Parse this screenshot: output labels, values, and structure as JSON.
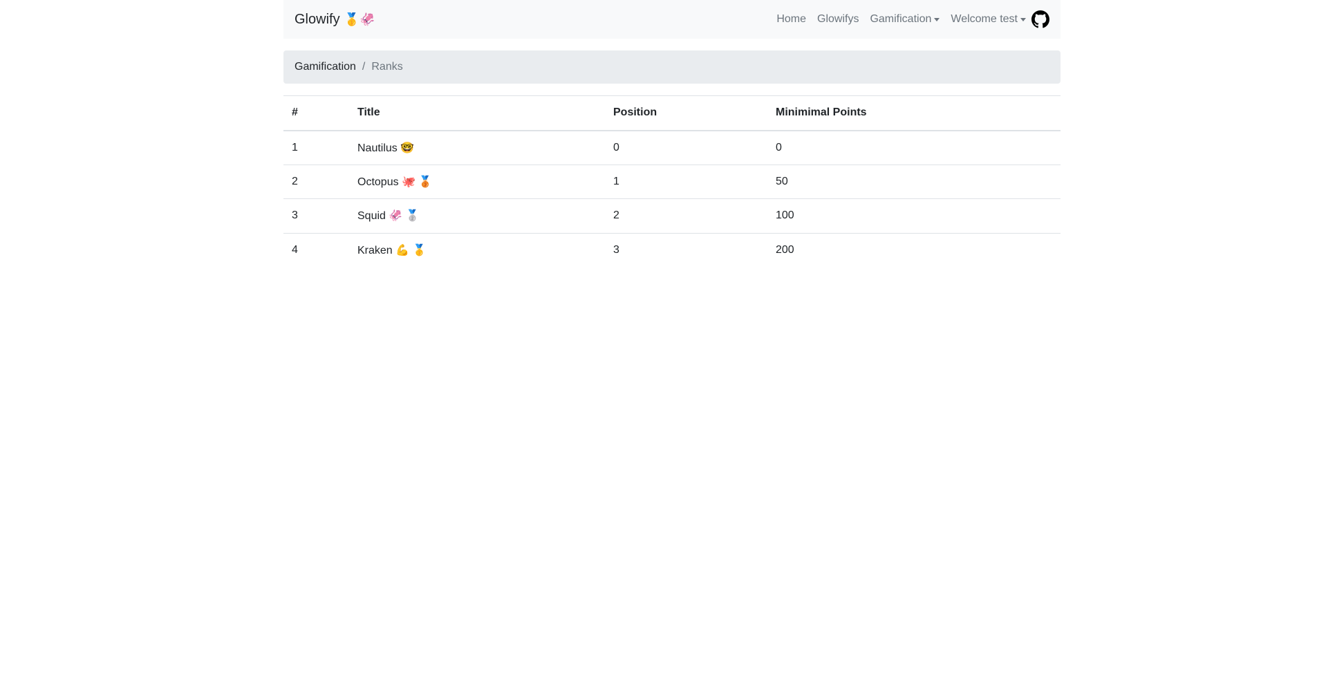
{
  "navbar": {
    "brand": "Glowify",
    "brand_icons": "🥇🦑",
    "links": {
      "home": "Home",
      "glowifys": "Glowifys",
      "gamification": "Gamification",
      "user": "Welcome test"
    },
    "github_icon": "github-icon"
  },
  "breadcrumb": {
    "parent": "Gamification",
    "current": "Ranks"
  },
  "table": {
    "headers": {
      "num": "#",
      "title": "Title",
      "position": "Position",
      "points": "Minimimal Points"
    },
    "rows": [
      {
        "num": "1",
        "title": "Nautilus 🤓",
        "position": "0",
        "points": "0"
      },
      {
        "num": "2",
        "title": "Octopus 🐙 🥉",
        "position": "1",
        "points": "50"
      },
      {
        "num": "3",
        "title": "Squid 🦑 🥈",
        "position": "2",
        "points": "100"
      },
      {
        "num": "4",
        "title": "Kraken 💪 🥇",
        "position": "3",
        "points": "200"
      }
    ]
  }
}
